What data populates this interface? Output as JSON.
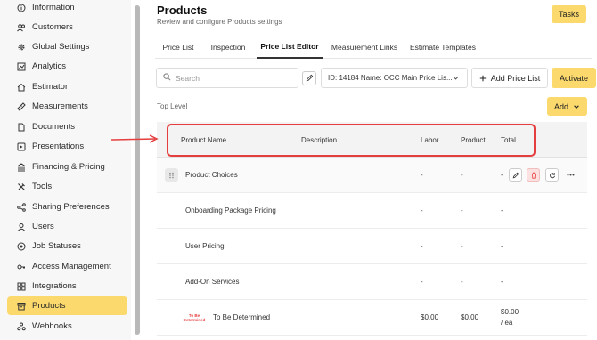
{
  "sidebar": {
    "items": [
      {
        "label": "Information",
        "icon": "info-icon"
      },
      {
        "label": "Customers",
        "icon": "users-icon"
      },
      {
        "label": "Global Settings",
        "icon": "gear-icon"
      },
      {
        "label": "Analytics",
        "icon": "analytics-icon"
      },
      {
        "label": "Estimator",
        "icon": "home-icon"
      },
      {
        "label": "Measurements",
        "icon": "ruler-icon"
      },
      {
        "label": "Documents",
        "icon": "document-icon"
      },
      {
        "label": "Presentations",
        "icon": "presentation-icon"
      },
      {
        "label": "Financing & Pricing",
        "icon": "bank-icon"
      },
      {
        "label": "Tools",
        "icon": "tools-icon"
      },
      {
        "label": "Sharing Preferences",
        "icon": "share-icon"
      },
      {
        "label": "Users",
        "icon": "user-icon"
      },
      {
        "label": "Job Statuses",
        "icon": "status-icon"
      },
      {
        "label": "Access Management",
        "icon": "key-icon"
      },
      {
        "label": "Integrations",
        "icon": "integrations-icon"
      },
      {
        "label": "Products",
        "icon": "box-icon",
        "active": true
      },
      {
        "label": "Webhooks",
        "icon": "webhook-icon"
      }
    ]
  },
  "header": {
    "title": "Products",
    "subtitle": "Review and configure Products settings",
    "tasks_label": "Tasks"
  },
  "tabs": [
    {
      "label": "Price List"
    },
    {
      "label": "Inspection"
    },
    {
      "label": "Price List Editor",
      "active": true
    },
    {
      "label": "Measurement Links"
    },
    {
      "label": "Estimate Templates"
    }
  ],
  "toolbar": {
    "search_placeholder": "Search",
    "price_list_selected": "ID: 14184 Name: OCC Main Price Lis...",
    "add_price_list_label": "Add Price List",
    "activate_label": "Activate"
  },
  "breadcrumb": "Top Level",
  "add_label": "Add",
  "table": {
    "columns": [
      "Product Name",
      "Description",
      "Labor",
      "Product",
      "Total"
    ],
    "rows": [
      {
        "name": "Product Choices",
        "labor": "-",
        "product": "-",
        "total": "-"
      },
      {
        "name": "Onboarding Package Pricing",
        "labor": "-",
        "product": "-",
        "total": "-"
      },
      {
        "name": "User Pricing",
        "labor": "-",
        "product": "-",
        "total": "-"
      },
      {
        "name": "Add-On Services",
        "labor": "-",
        "product": "-",
        "total": "-"
      },
      {
        "name": "To Be Determined",
        "labor": "$0.00",
        "product": "$0.00",
        "total": "$0.00",
        "total_unit": "/ ea",
        "badge_line1": "To Be",
        "badge_line2": "Determined"
      }
    ]
  },
  "colors": {
    "accent": "#fbd96c",
    "annotation": "#e53e3e",
    "sidebar_bg": "#f7f7f7"
  }
}
